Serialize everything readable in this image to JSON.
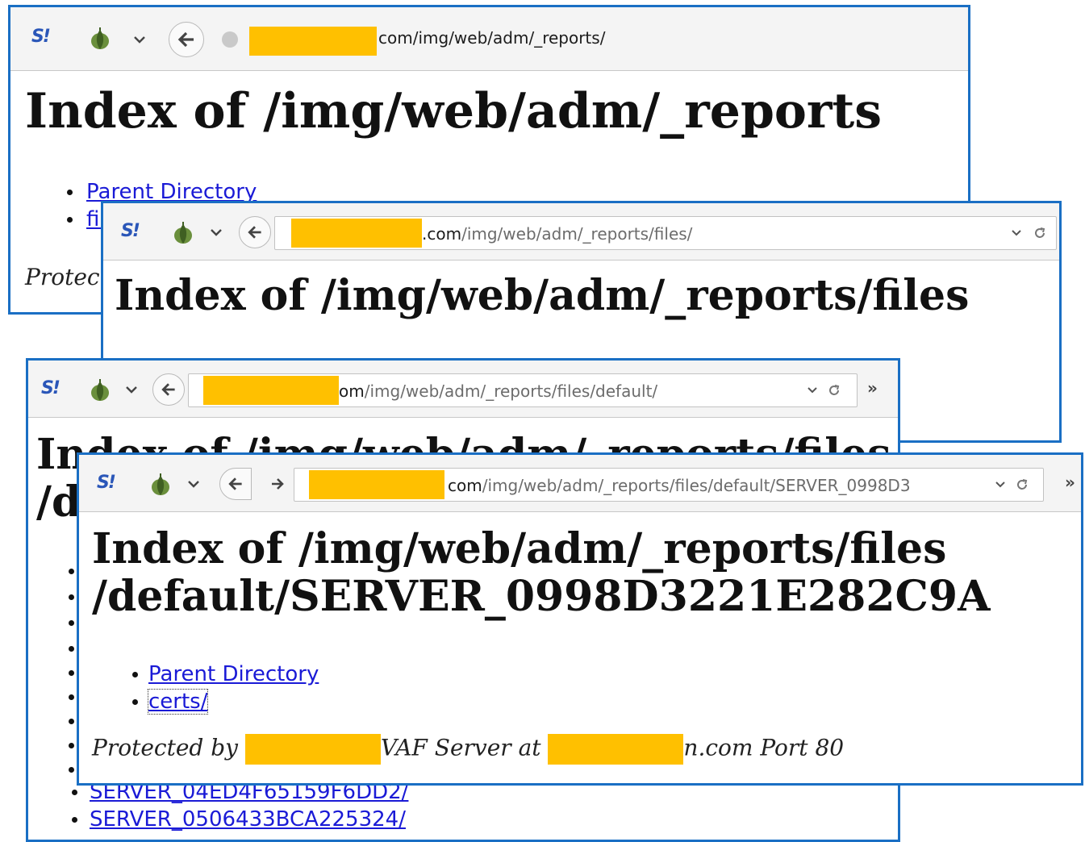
{
  "windows": [
    {
      "url": {
        "suffix": "com/img/web/adm/_reports/",
        "muted": ""
      },
      "heading": [
        "Index of /img/web/adm/_reports"
      ],
      "links": [
        "Parent Directory",
        "files/"
      ],
      "footer": "Protected by"
    },
    {
      "url": {
        "suffix": ".com",
        "muted": "/img/web/adm/_reports/files/"
      },
      "heading": [
        "Index of /img/web/adm/_reports/files"
      ]
    },
    {
      "url": {
        "suffix": "om",
        "muted": "/img/web/adm/_reports/files/default/"
      },
      "heading": [
        "Index of /img/web/adm/_reports/files",
        "/default"
      ],
      "links_visible": [
        "SERVER_04ED4F65159F6DD2/",
        "SERVER_0506433BCA225324/"
      ]
    },
    {
      "url": {
        "suffix": "com",
        "muted": "/img/web/adm/_reports/files/default/SERVER_0998D3"
      },
      "heading": [
        "Index of /img/web/adm/_reports/files",
        "/default/SERVER_0998D3221E282C9A"
      ],
      "links": [
        "Parent Directory",
        "certs/"
      ],
      "footer": {
        "part1": "Protected by",
        "part2": "VAF Server at",
        "part3": "n.com Port 80"
      }
    }
  ],
  "icons": {
    "logo": "S!",
    "onion": "onion-icon",
    "back": "back-arrow-icon",
    "forward": "forward-arrow-icon",
    "reload": "reload-icon",
    "overflow": "»"
  },
  "colors": {
    "window_border": "#1a6fc4",
    "redaction": "#ffc000",
    "link": "#1a1ad6"
  }
}
